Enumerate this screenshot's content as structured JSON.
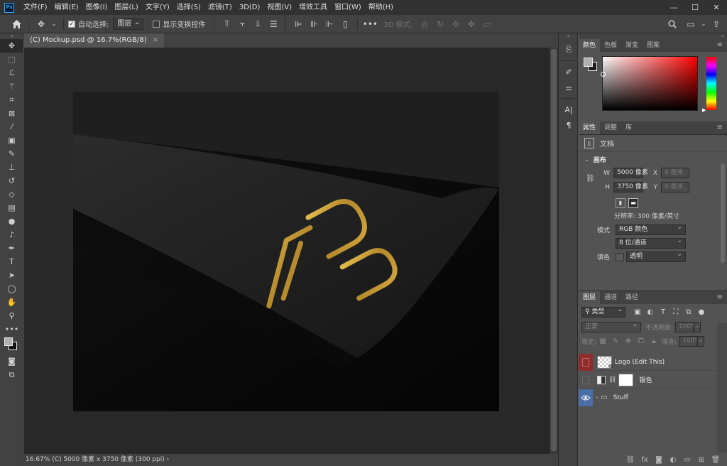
{
  "app": {
    "logo": "Ps"
  },
  "menu": [
    "文件(F)",
    "编辑(E)",
    "图像(I)",
    "图层(L)",
    "文字(Y)",
    "选择(S)",
    "滤镜(T)",
    "3D(D)",
    "视图(V)",
    "增效工具",
    "窗口(W)",
    "帮助(H)"
  ],
  "window_controls": {
    "minimize": "—",
    "maximize": "☐",
    "close": "✕"
  },
  "options": {
    "auto_select_label": "自动选择:",
    "auto_select_checked": true,
    "auto_select_target": "图层",
    "show_transform_label": "显示变换控件",
    "show_transform_checked": false,
    "more_label": "•••",
    "mode_3d_label": "3D 模式:"
  },
  "document": {
    "tab_title": "(C) Mockup.psd @ 16.7%(RGB/8)",
    "tab_close": "×",
    "status": "16.67%  (C) 5000 像素 x 3750 像素 (300 ppi)",
    "status_arrow": "›"
  },
  "color_panel": {
    "tabs": [
      "颜色",
      "色板",
      "渐变",
      "图案"
    ],
    "active_tab": 0,
    "foreground": "#b0b0b0",
    "background": "#1d1d1d",
    "hue": "#ff0000"
  },
  "properties": {
    "tabs": [
      "属性",
      "调整",
      "库"
    ],
    "doc_label": "文档",
    "canvas_section": "画布",
    "w_label": "W",
    "w_value": "5000 像素",
    "x_label": "X",
    "x_value": "0 厘米",
    "h_label": "H",
    "h_value": "3750 像素",
    "y_label": "Y",
    "y_value": "0 厘米",
    "resolution": "分辨率: 300 像素/英寸",
    "mode_label": "模式",
    "mode_value": "RGB 颜色",
    "bit_depth": "8 位/通道",
    "fill_label": "填色",
    "fill_value": "透明"
  },
  "layers": {
    "tabs": [
      "图层",
      "通道",
      "路径"
    ],
    "kind_filter": "类型",
    "blend_mode": "正常",
    "opacity_label": "不透明度:",
    "opacity_value": "100%",
    "lock_label": "锁定:",
    "fill_label": "填充:",
    "fill_value": "100%",
    "items": [
      {
        "name": "Logo (Edit This)",
        "visible": false
      },
      {
        "name": "银色",
        "visible": false
      },
      {
        "name": "Stuff",
        "visible": true
      }
    ]
  },
  "colors": {
    "accent_blue": "#4a6fa5",
    "logo_gold": "#c9a33f",
    "layer_red": "#8f2c2c"
  }
}
